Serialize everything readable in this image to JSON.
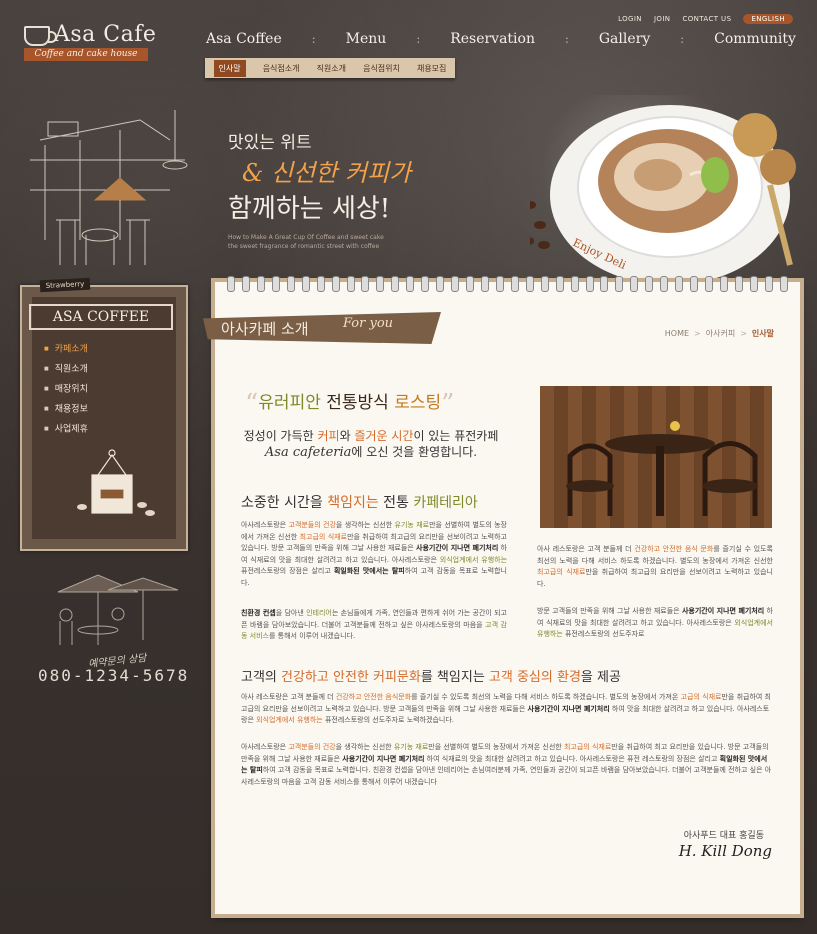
{
  "logo": {
    "name": "Asa Cafe",
    "tagline": "Coffee and cake house"
  },
  "utility": {
    "login": "LOGIN",
    "join": "JOIN",
    "contact": "CONTACT US",
    "english": "ENGLISH"
  },
  "gnb": {
    "items": [
      "Asa Coffee",
      "Menu",
      "Reservation",
      "Gallery",
      "Community"
    ],
    "sep": ":"
  },
  "subnav": [
    "인사말",
    "음식점소개",
    "직원소개",
    "음식점위치",
    "채용모집"
  ],
  "hero": {
    "line1": "맛있는 위트",
    "line2": "& 신선한 커피가",
    "line3": "함께하는 세상!",
    "caption1": "How to Make A Great Cup Of Coffee and sweet cake",
    "caption2": "the sweet fragrance of romantic street with coffee",
    "saucer_text": "Enjoy Deli"
  },
  "sidebar": {
    "badge": "Strawberry",
    "title": "ASA COFFEE",
    "items": [
      {
        "label": "카페소개",
        "active": true
      },
      {
        "label": "직원소개",
        "active": false
      },
      {
        "label": "매장위치",
        "active": false
      },
      {
        "label": "채용정보",
        "active": false
      },
      {
        "label": "사업제휴",
        "active": false
      }
    ],
    "phone_note": "예약문의 상담",
    "phone": "080-1234-5678"
  },
  "content": {
    "section_title": "아사카페 소개",
    "section_title_en": "For you",
    "breadcrumb": [
      "HOME",
      "아사커피",
      "인사말"
    ],
    "headline": {
      "open_quote": "“",
      "part1": "유러피안",
      "part2": " 전통방식 ",
      "part3": "로스팅",
      "close_quote": "”"
    },
    "intro": {
      "line1_a": "정성이 가득한 ",
      "line1_b": "커피",
      "line1_c": "와 ",
      "line1_d": "즐거운 시간",
      "line1_e": "이 있는 퓨전카페",
      "line2_a": "Asa cafeteria",
      "line2_b": "에 오신 것을 환영합니다."
    },
    "heading2": {
      "a": "소중한 시간을 ",
      "b": "책임지는",
      "c": " 전통 ",
      "d": "카페테리아"
    },
    "para1": {
      "a": "아사레스토랑은 ",
      "b": "고객분들의 건강",
      "c": "을 생각하는 신선한 ",
      "d": "유기농 재료",
      "e": "만을 선별하여 별도의 농장에서 가져온 신선한 ",
      "f": "최고급의 식재료",
      "g": "만을 취급하여 최고급의 요리만을 선보이려고 노력하고 있습니다. 방문 고객들의 만족을 위해 그날 사용한 재료들은 ",
      "h": "사용기간이 지나면 폐기처리",
      "i": " 하여 식재료의 맛을 최대한 살려려고 하고 있습니다. 아사레스토랑은 ",
      "j": "외식업계에서 유행하는",
      "k": " 퓨전레스토랑의 장점은 살리고 ",
      "l": "획일화된 맛에서는 탈피",
      "m": "하여 고객 감동을 목표로 노력합니다."
    },
    "para2": {
      "a": "친환경 컨셉",
      "b": "을 담아낸 ",
      "c": "인테리어",
      "d": "는 손님들에게 가족, 연인들과 편하게 쉬어 가는 공간이 되고픈 바램을 담아보았습니다. 더불어 고객분들께 전하고 싶은 아사레스토랑의 마음을 ",
      "e": "고객 감동 서비스",
      "f": "를 통해서 이루어 내겠습니다."
    },
    "right1": {
      "a": "아사 레스토랑은 고객 분들께 더 ",
      "b": "건강하고 안전한 음식 문화",
      "c": "를 즐기실 수 있도록 최선의 노력을 다해 서비스 하도록 하겠습니다. 별도의 농장에서 가져온 신선한 ",
      "d": "최고급의 식재료",
      "e": "만을 취급하여 최고급의 요리만을 선보이려고 노력하고 있습니다."
    },
    "right2": {
      "a": "방문 고객들의 만족을 위해 그날 사용한 재료들은 ",
      "b": "사용기간이 지나면 폐기처리",
      "c": " 하여 식재료의 맛을 최대한 살려려고 하고 있습니다. 아사레스토랑은 ",
      "d": "외식업계에서 유행하는",
      "e": " 퓨전레스토랑의 선도주자로"
    },
    "heading3": {
      "a": "고객의 ",
      "b": "건강하고 안전한 커피문화",
      "c": "를 책임지는 ",
      "d": "고객 중심의 환경",
      "e": "을 제공"
    },
    "para3": {
      "a": "아사 레스토랑은 고객 분들께 더 ",
      "b": "건강하고 안전한 음식문화",
      "c": "를 즐기실 수 있도록 최선의 노력을 다해 서비스 하도록 하겠습니다. 별도의 농장에서 가져온 ",
      "d": "고급의 식재료",
      "e": "만을 취급하여 최고급의 요리만을 선보이려고 노력하고 있습니다. 방문 고객들의 만족을 위해 그날 사용한 재료들은 ",
      "f": "사용기간이 지나면 폐기처리",
      "g": " 하여 맛을 최대한 살려려고 하고 있습니다. 아사레스토랑은 ",
      "h": "외식업계에서 유행하는",
      "i": " 퓨전레스토랑의 선도주자로 노력하겠습니다."
    },
    "para4": {
      "a": "아사레스토랑은 ",
      "b": "고객분들의 건강",
      "c": "을 생각하는 신선한 ",
      "d": "유기농 재료",
      "e": "만을 선별하여 별도의 농장에서 가져온 신선한 ",
      "f": "최고급의 식재료",
      "g": "만을 취급하여 최고 요리만을 있습니다. 방문 고객들의 만족을 위해 그날 사용한 재료들은 ",
      "h": "사용기간이 지나면 폐기처리",
      "i": " 하여 식재료의 맛을 최대한 살려려고 하고 있습니다. 아사레스토랑은 퓨전 레스토랑의 장점은 살리고 ",
      "j": "획일화된 맛에서는 탈피",
      "k": "하여 고객 감동을 목표로 노력합니다. 친환경 컨셉을 담아낸 인테리어는 손님여러분께 가족, 연인들과 공간이 되고픈 바램을 담아보았습니다. 더불어 고객분들께 전하고 싶은 아사레스토랑의 마음을 고객 감동 서비스를 통해서 이루어 내겠습니다"
    },
    "signature_label": "아사푸드 대표 홍길동",
    "signature": "H. Kill Dong"
  },
  "colors": {
    "accent": "#a7552a",
    "green": "#7d8a2a",
    "orange": "#d46b2b",
    "bg": "#3b3431",
    "paper": "#fbf8f2"
  }
}
